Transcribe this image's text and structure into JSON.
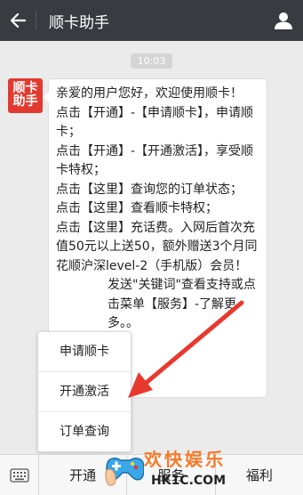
{
  "header": {
    "title": "顺卡助手",
    "back_icon": "arrow-left-icon",
    "profile_icon": "person-icon"
  },
  "timestamp": "10:03",
  "avatar": {
    "line1": "顺卡",
    "line2": "助手"
  },
  "message": {
    "greeting": "亲爱的用户您好，欢迎使用顺卡！",
    "line1": "点击【开通】-【申请顺卡】，申请顺卡；",
    "line2": "点击【开通】-【开通激活】，享受顺卡特权；",
    "line3": "点击【这里】查询您的订单状态；",
    "line4": "点击【这里】查看顺卡特权；",
    "line5": "点击【这里】充话费。入网后首次充值50元以上送50，额外赠送3个月同花顺沪深level-2（手机版）会员！",
    "line6": "发送\"关键词\"查看支持或点击菜单【服务】-了解更多。。"
  },
  "popup_menu": {
    "items": [
      "申请顺卡",
      "开通激活",
      "订单查询"
    ]
  },
  "bottom_menu": {
    "keyboard_icon": "keyboard-icon",
    "tabs": [
      "开通",
      "服务",
      "福利"
    ]
  },
  "watermark": {
    "text": "欢快娱乐",
    "url": "HK1C.COM"
  },
  "colors": {
    "topbar": "#383b40",
    "brand_red": "#e23a2f",
    "arrow": "#e8392e",
    "watermark_orange": "#f57a2a"
  }
}
